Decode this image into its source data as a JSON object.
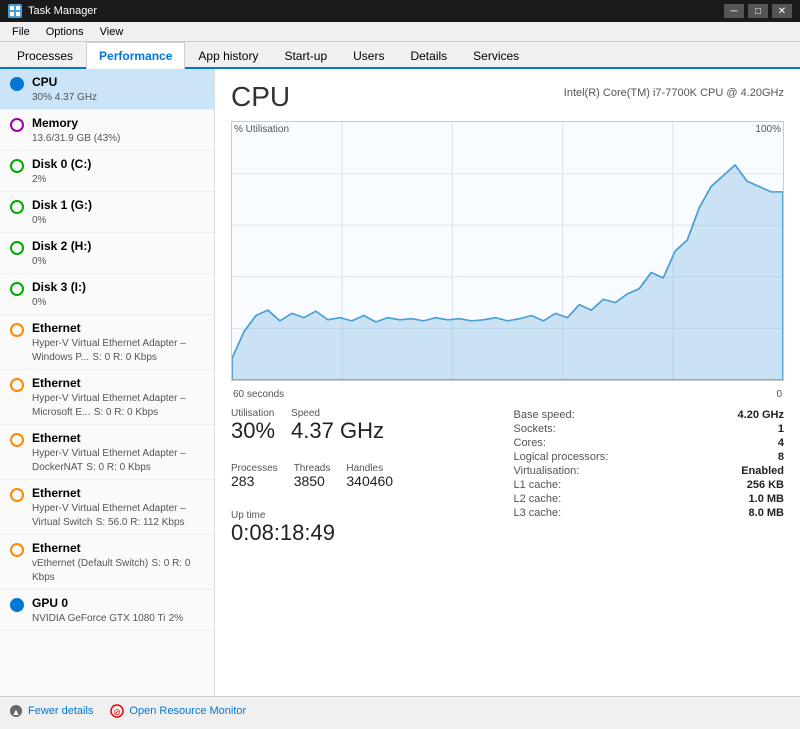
{
  "titleBar": {
    "icon": "⚙",
    "title": "Task Manager",
    "minimize": "─",
    "maximize": "□",
    "close": "✕"
  },
  "menuBar": {
    "items": [
      "File",
      "Options",
      "View"
    ]
  },
  "tabs": [
    {
      "label": "Processes",
      "active": false
    },
    {
      "label": "Performance",
      "active": true
    },
    {
      "label": "App history",
      "active": false
    },
    {
      "label": "Start-up",
      "active": false
    },
    {
      "label": "Users",
      "active": false
    },
    {
      "label": "Details",
      "active": false
    },
    {
      "label": "Services",
      "active": false
    }
  ],
  "sidebar": {
    "items": [
      {
        "name": "CPU",
        "value": "30% 4.37 GHz",
        "indicator": "blue",
        "active": true
      },
      {
        "name": "Memory",
        "value": "13.6/31.9 GB (43%)",
        "indicator": "purple",
        "active": false
      },
      {
        "name": "Disk 0 (C:)",
        "value": "2%",
        "indicator": "green",
        "active": false
      },
      {
        "name": "Disk 1 (G:)",
        "value": "0%",
        "indicator": "green",
        "active": false
      },
      {
        "name": "Disk 2 (H:)",
        "value": "0%",
        "indicator": "green",
        "active": false
      },
      {
        "name": "Disk 3 (I:)",
        "value": "0%",
        "indicator": "green",
        "active": false
      },
      {
        "name": "Ethernet",
        "value": "Hyper-V Virtual Ethernet Adapter – Windows P...",
        "sub": "S: 0 R: 0 Kbps",
        "indicator": "orange",
        "active": false
      },
      {
        "name": "Ethernet",
        "value": "Hyper-V Virtual Ethernet Adapter – Microsoft E...",
        "sub": "S: 0 R: 0 Kbps",
        "indicator": "orange",
        "active": false
      },
      {
        "name": "Ethernet",
        "value": "Hyper-V Virtual Ethernet Adapter – DockerNAT",
        "sub": "S: 0 R: 0 Kbps",
        "indicator": "orange",
        "active": false
      },
      {
        "name": "Ethernet",
        "value": "Hyper-V Virtual Ethernet Adapter – Virtual Switch",
        "sub": "S: 56.0 R: 112 Kbps",
        "indicator": "orange",
        "active": false
      },
      {
        "name": "Ethernet",
        "value": "vEthernet (Default Switch)",
        "sub": "S: 0 R: 0 Kbps",
        "indicator": "orange",
        "active": false
      },
      {
        "name": "GPU 0",
        "value": "NVIDIA GeForce GTX 1080 Ti",
        "sub": "2%",
        "indicator": "blue",
        "active": false
      }
    ]
  },
  "detail": {
    "title": "CPU",
    "subtitle": "Intel(R) Core(TM) i7-7700K CPU @ 4.20GHz",
    "chart": {
      "yLabel": "% Utilisation",
      "yMax": "100%",
      "xLeft": "60 seconds",
      "xRight": "0"
    },
    "stats": {
      "utilisation_label": "Utilisation",
      "utilisation_value": "30%",
      "speed_label": "Speed",
      "speed_value": "4.37 GHz",
      "processes_label": "Processes",
      "processes_value": "283",
      "threads_label": "Threads",
      "threads_value": "3850",
      "handles_label": "Handles",
      "handles_value": "340460",
      "uptime_label": "Up time",
      "uptime_value": "0:08:18:49"
    },
    "info": {
      "base_speed_label": "Base speed:",
      "base_speed_value": "4.20 GHz",
      "sockets_label": "Sockets:",
      "sockets_value": "1",
      "cores_label": "Cores:",
      "cores_value": "4",
      "logical_label": "Logical processors:",
      "logical_value": "8",
      "virtualisation_label": "Virtualisation:",
      "virtualisation_value": "Enabled",
      "l1_label": "L1 cache:",
      "l1_value": "256 KB",
      "l2_label": "L2 cache:",
      "l2_value": "1.0 MB",
      "l3_label": "L3 cache:",
      "l3_value": "8.0 MB"
    }
  },
  "bottomBar": {
    "fewer_details": "Fewer details",
    "open_resource_monitor": "Open Resource Monitor"
  }
}
